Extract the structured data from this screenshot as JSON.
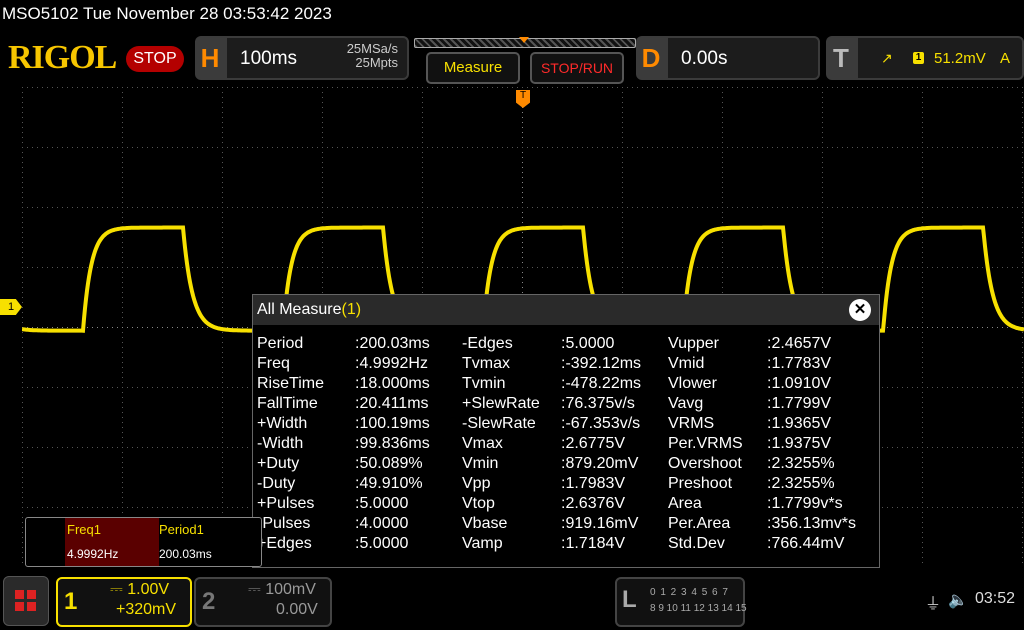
{
  "title": "MSO5102  Tue November 28 03:53:42 2023",
  "brand": "RIGOL",
  "run_state": "STOP",
  "horizontal": {
    "letter": "H",
    "timebase": "100ms",
    "sample_rate": "25MSa/s",
    "memory_depth": "25Mpts"
  },
  "buttons": {
    "measure": "Measure",
    "stop_run": "STOP/RUN"
  },
  "delay": {
    "letter": "D",
    "value": "0.00s"
  },
  "trigger": {
    "letter": "T",
    "edge_symbol": "↗",
    "channel": "1",
    "level": "51.2mV",
    "source": "A",
    "marker": "T"
  },
  "channel1_marker": "1",
  "all_measure": {
    "title": "All Measure",
    "channel": "(1)",
    "close_symbol": "✕",
    "col1": [
      {
        "name": "Period",
        "value": ":200.03ms"
      },
      {
        "name": "Freq",
        "value": ":4.9992Hz"
      },
      {
        "name": "RiseTime",
        "value": ":18.000ms"
      },
      {
        "name": "FallTime",
        "value": ":20.411ms"
      },
      {
        "name": "+Width",
        "value": ":100.19ms"
      },
      {
        "name": "-Width",
        "value": ":99.836ms"
      },
      {
        "name": "+Duty",
        "value": ":50.089%"
      },
      {
        "name": "-Duty",
        "value": ":49.910%"
      },
      {
        "name": "+Pulses",
        "value": ":5.0000"
      },
      {
        "name": "-Pulses",
        "value": ":4.0000"
      },
      {
        "name": "+Edges",
        "value": ":5.0000"
      }
    ],
    "col2": [
      {
        "name": "-Edges",
        "value": ":5.0000"
      },
      {
        "name": "Tvmax",
        "value": ":-392.12ms"
      },
      {
        "name": "Tvmin",
        "value": ":-478.22ms"
      },
      {
        "name": "+SlewRate",
        "value": ":76.375v/s"
      },
      {
        "name": "-SlewRate",
        "value": ":-67.353v/s"
      },
      {
        "name": "Vmax",
        "value": ":2.6775V"
      },
      {
        "name": "Vmin",
        "value": ":879.20mV"
      },
      {
        "name": "Vpp",
        "value": ":1.7983V"
      },
      {
        "name": "Vtop",
        "value": ":2.6376V"
      },
      {
        "name": "Vbase",
        "value": ":919.16mV"
      },
      {
        "name": "Vamp",
        "value": ":1.7184V"
      }
    ],
    "col3": [
      {
        "name": "Vupper",
        "value": ":2.4657V"
      },
      {
        "name": "Vmid",
        "value": ":1.7783V"
      },
      {
        "name": "Vlower",
        "value": ":1.0910V"
      },
      {
        "name": "Vavg",
        "value": ":1.7799V"
      },
      {
        "name": "VRMS",
        "value": ":1.9365V"
      },
      {
        "name": "Per.VRMS",
        "value": ":1.9375V"
      },
      {
        "name": "Overshoot",
        "value": ":2.3255%"
      },
      {
        "name": "Preshoot",
        "value": ":2.3255%"
      },
      {
        "name": "Area",
        "value": ":1.7799v*s"
      },
      {
        "name": "Per.Area",
        "value": ":356.13mv*s"
      },
      {
        "name": "Std.Dev",
        "value": ":766.44mV"
      }
    ]
  },
  "quick_measure": [
    {
      "label": "Freq1",
      "value": "4.9992Hz"
    },
    {
      "label": "Period1",
      "value": "200.03ms"
    }
  ],
  "channel1": {
    "number": "1",
    "scale": "1.00V",
    "offset": "+320mV",
    "color": "#f7e000"
  },
  "channel2": {
    "number": "2",
    "scale": "100mV",
    "offset": "0.00V"
  },
  "logic": {
    "letter": "L",
    "row1": "0 1 2 3  4 5 6 7",
    "row2": "8 9 10 11 12 13 14 15"
  },
  "status": {
    "usb_symbol": "⏚",
    "speaker_symbol": "🔈",
    "time": "03:52"
  },
  "waveform": {
    "type": "square",
    "period_divisions": 2.0003,
    "high_V": 2.6376,
    "low_V": 0.91916,
    "offset_V": 0.32,
    "volts_per_div": 1.0,
    "rise_time_ms": 18.0,
    "fall_time_ms": 20.411,
    "timebase_ms_per_div": 100
  }
}
